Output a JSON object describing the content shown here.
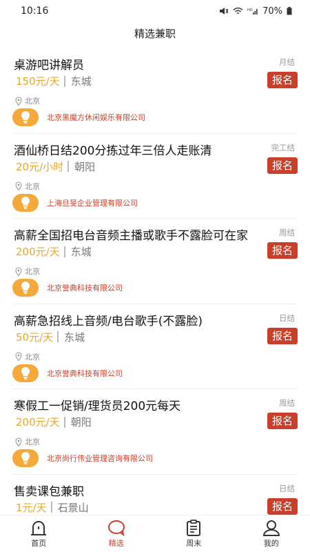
{
  "status_bar": {
    "time": "10:16",
    "battery": "70%"
  },
  "page_title": "精选兼职",
  "jobs": [
    {
      "title": "桌游吧讲解员",
      "settlement": "月结",
      "salary": "150元/天",
      "district": "东城",
      "location": "北京",
      "company": "北京黑魔方休闲娱乐有限公司",
      "apply": "报名"
    },
    {
      "title": "酒仙桥日结200分拣过年三倍人走账清",
      "settlement": "完工结",
      "salary": "20元/小时",
      "district": "朝阳",
      "location": "北京",
      "company": "上海旦旻企业管理有限公司",
      "apply": "报名"
    },
    {
      "title": "高薪全国招电台音频主播或歌手不露脸可在家",
      "settlement": "周结",
      "salary": "200元/天",
      "district": "东城",
      "location": "北京",
      "company": "北京誉典科技有限公司",
      "apply": "报名"
    },
    {
      "title": "高薪急招线上音频/电台歌手(不露脸)",
      "settlement": "日结",
      "salary": "50元/天",
      "district": "东城",
      "location": "北京",
      "company": "北京誉典科技有限公司",
      "apply": "报名"
    },
    {
      "title": "寒假工一促销/理货员200元每天",
      "settlement": "周结",
      "salary": "200元/天",
      "district": "朝阳",
      "location": "北京",
      "company": "北京尚行伟业管理咨询有限公司",
      "apply": "报名"
    },
    {
      "title": "售卖课包兼职",
      "settlement": "日结",
      "salary": "1元/天",
      "district": "石景山",
      "location": "",
      "company": "",
      "apply": "报名"
    }
  ],
  "tabs": [
    {
      "label": "首页",
      "icon": "home-icon"
    },
    {
      "label": "精选",
      "icon": "chat-bubble-icon"
    },
    {
      "label": "周末",
      "icon": "clipboard-icon"
    },
    {
      "label": "我的",
      "icon": "user-icon"
    }
  ],
  "colors": {
    "accent": "#c8402b",
    "salary": "#e7a82a",
    "badge": "#f4a93a"
  }
}
